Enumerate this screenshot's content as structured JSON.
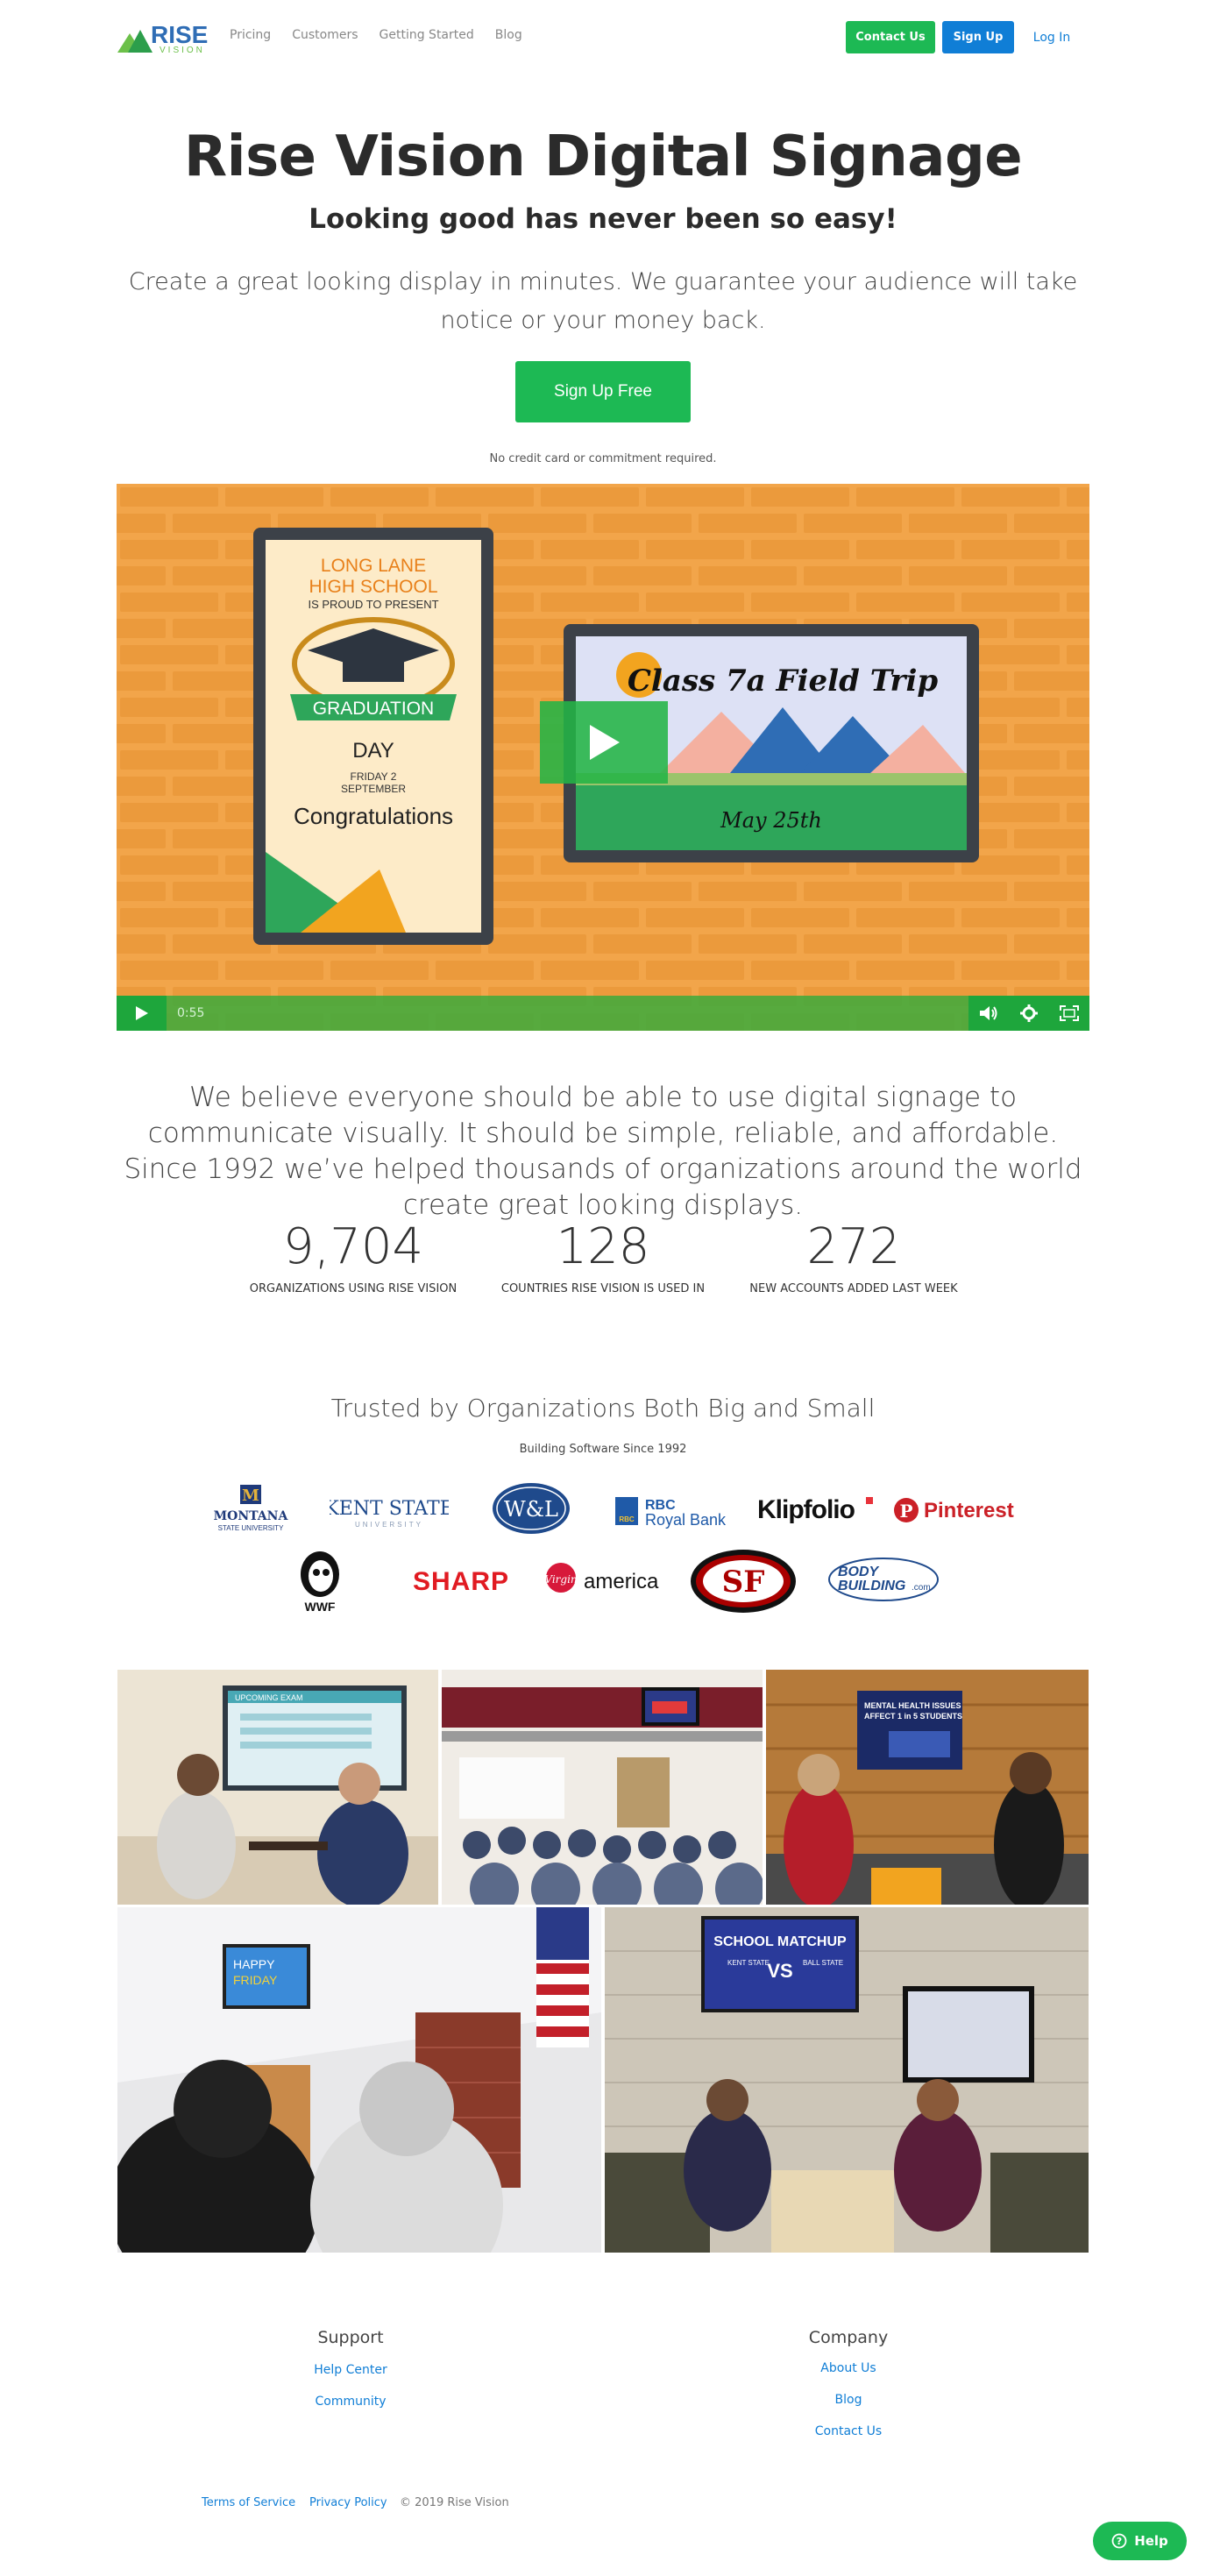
{
  "nav": {
    "logo_text_top": "RISE",
    "logo_text_bottom": "VISION",
    "links": [
      "Pricing",
      "Customers",
      "Getting Started",
      "Blog"
    ],
    "contact_label": "Contact Us",
    "signup_label": "Sign Up",
    "login_label": "Log In"
  },
  "hero": {
    "title": "Rise Vision Digital Signage",
    "subtitle": "Looking good has never been so easy!",
    "description": "Create a great looking display in minutes. We guarantee your audience will take notice or your money back.",
    "cta_label": "Sign Up Free",
    "note": "No credit card or commitment required."
  },
  "video": {
    "duration": "0:55",
    "poster_left": {
      "line1": "LONG LANE",
      "line2": "HIGH SCHOOL",
      "line3": "IS PROUD TO PRESENT",
      "banner": "GRADUATION",
      "line4": "DAY",
      "line5": "FRIDAY 2",
      "line6": "SEPTEMBER",
      "line7": "Congratulations"
    },
    "poster_right": {
      "title": "Class 7a Field Trip",
      "date": "May 25th"
    }
  },
  "mission": {
    "text": "We believe everyone should be able to use digital signage to communicate visually. It should be simple, reliable, and affordable. Since 1992 we’ve helped thousands of organizations around the world create great looking displays."
  },
  "stats": [
    {
      "value": "9,704",
      "label": "ORGANIZATIONS USING RISE VISION"
    },
    {
      "value": "128",
      "label": "COUNTRIES RISE VISION IS USED IN"
    },
    {
      "value": "272",
      "label": "NEW ACCOUNTS ADDED LAST WEEK"
    }
  ],
  "trusted": {
    "title": "Trusted by Organizations Both Big and Small",
    "subtitle": "Building Software Since 1992",
    "logos": {
      "montana_1": "MONTANA",
      "montana_2": "STATE UNIVERSITY",
      "kent_1": "KENT STATE",
      "kent_2": "UNIVERSITY",
      "wl": "W&L",
      "rbc_1": "RBC",
      "rbc_2": "Royal Bank",
      "rbc_badge": "RBC",
      "klipfolio": "Klipfolio",
      "pinterest": "Pinterest",
      "wwf": "WWF",
      "sharp": "SHARP",
      "virgin": "Virgin",
      "virgin_2": "america",
      "sf": "SF",
      "bb_1": "BODY",
      "bb_2": "BUILDING",
      "bb_3": ".com"
    }
  },
  "photos": {
    "p1_screen": "UPCOMING EXAM",
    "p3_screen_1": "MENTAL HEALTH ISSUES",
    "p3_screen_2": "AFFECT 1 in 5 STUDENTS",
    "p4_screen_1": "HAPPY",
    "p4_screen_2": "FRIDAY",
    "p5_screen_1": "SCHOOL MATCHUP",
    "p5_screen_2": "KENT STATE",
    "p5_screen_3": "VS",
    "p5_screen_4": "BALL STATE"
  },
  "footer": {
    "support_title": "Support",
    "support_links": [
      "Help Center",
      "Community"
    ],
    "company_title": "Company",
    "company_links": [
      "About Us",
      "Blog",
      "Contact Us"
    ],
    "terms": "Terms of Service",
    "privacy": "Privacy Policy",
    "copyright": "© 2019 Rise Vision",
    "help_label": "Help"
  },
  "colors": {
    "brand_green": "#1db954",
    "brand_blue": "#107ed6",
    "video_bg": "#f2a54a"
  }
}
